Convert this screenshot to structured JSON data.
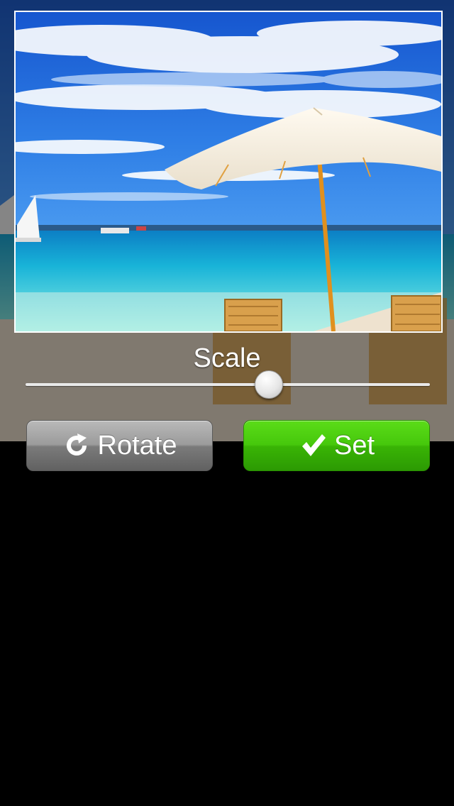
{
  "editor": {
    "scale_label": "Scale",
    "scale_value": 0.6
  },
  "buttons": {
    "rotate_label": "Rotate",
    "rotate_icon": "rotate-clockwise-icon",
    "set_label": "Set",
    "set_icon": "checkmark-icon"
  },
  "colors": {
    "set_button": "#3fbf08",
    "rotate_button": "#8c8c8c",
    "background": "#000000"
  }
}
